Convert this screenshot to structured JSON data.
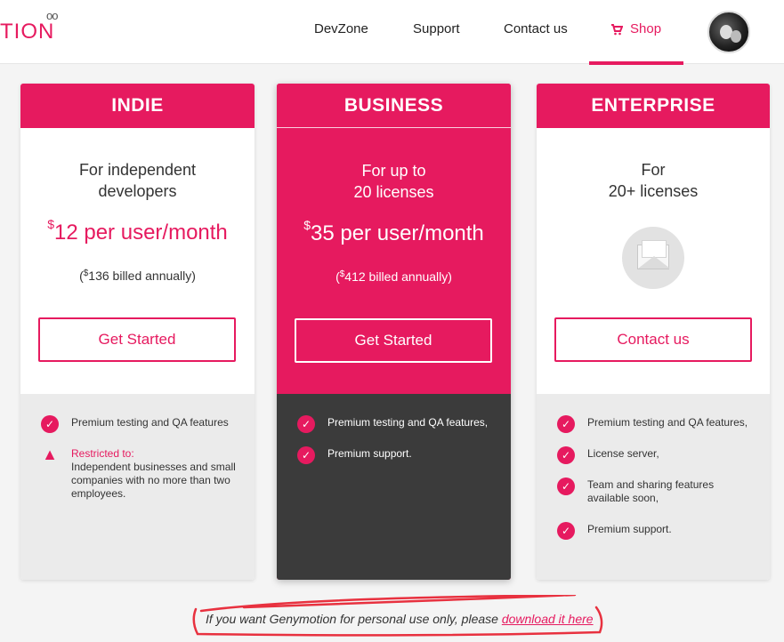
{
  "header": {
    "logo_text": "TION",
    "logo_rings": "oo",
    "nav": [
      "DevZone",
      "Support",
      "Contact us"
    ],
    "shop_label": "Shop",
    "shop_icon": "cart-icon"
  },
  "plans": {
    "indie": {
      "title": "INDIE",
      "subtitle": "For independent developers",
      "price_currency": "$",
      "price": "12 per user/month",
      "billed_open": "(",
      "billed_currency": "$",
      "billed": "136 billed annually)",
      "cta": "Get Started",
      "features": [
        "Premium testing and QA features"
      ],
      "restriction_title": "Restricted to:",
      "restriction_text": "Independent businesses and small companies with no more than two employees."
    },
    "business": {
      "title": "BUSINESS",
      "subtitle_line1": "For up to",
      "subtitle_line2": "20 licenses",
      "price_currency": "$",
      "price": "35 per user/month",
      "billed_open": "(",
      "billed_currency": "$",
      "billed": "412 billed annually)",
      "cta": "Get Started",
      "features": [
        "Premium testing and QA features,",
        "Premium support."
      ]
    },
    "enterprise": {
      "title": "ENTERPRISE",
      "subtitle_line1": "For",
      "subtitle_line2": "20+ licenses",
      "cta": "Contact us",
      "features": [
        "Premium testing and QA features,",
        "License server,",
        "Team and sharing features available soon,",
        "Premium support."
      ]
    }
  },
  "footer": {
    "note": "If you want Genymotion for personal use only, please ",
    "link": "download it here"
  },
  "colors": {
    "accent": "#e61a5f",
    "dark_panel": "#3b3b3b",
    "light_panel": "#ebebeb",
    "annotation": "#e8313f"
  }
}
